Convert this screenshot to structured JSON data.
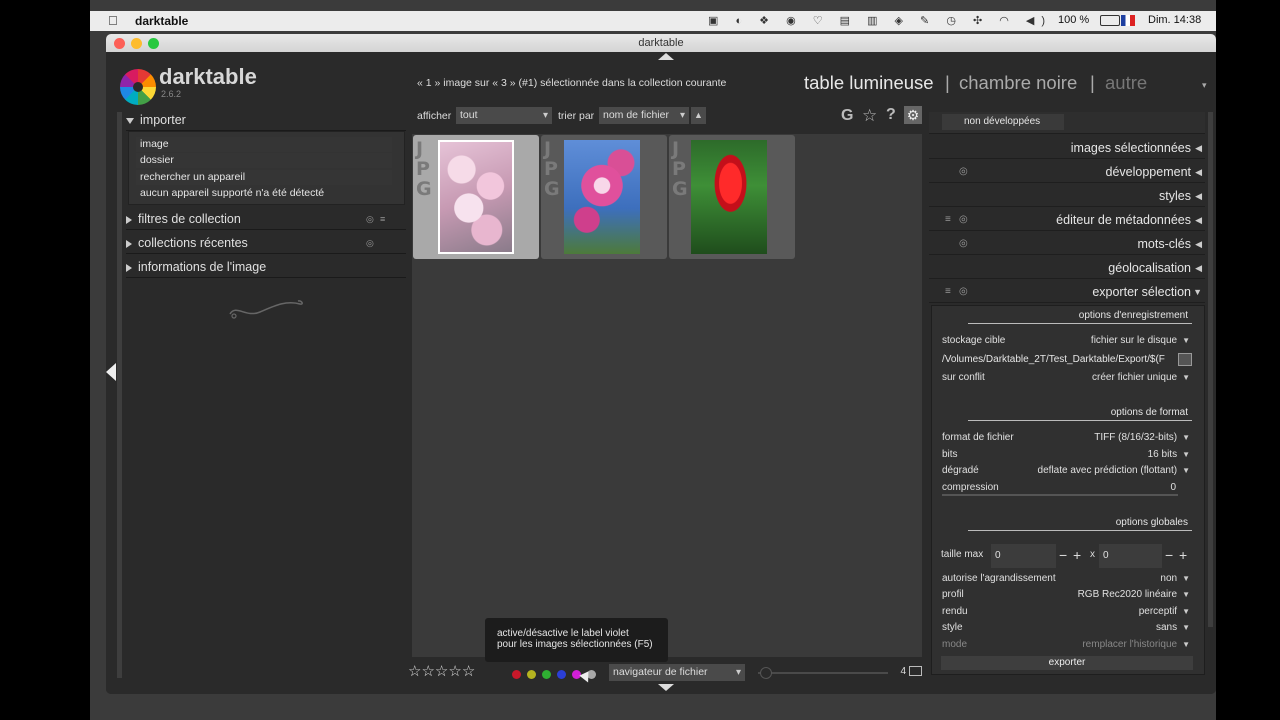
{
  "menubar": {
    "apple": "",
    "app_name": "darktable",
    "battery": "100 %",
    "datetime": "Dim. 14:38"
  },
  "window": {
    "title": "darktable"
  },
  "logo": {
    "name": "darktable",
    "version": "2.6.2"
  },
  "views": {
    "lighttable": "table lumineuse",
    "sep1": "|",
    "darkroom": "chambre noire",
    "sep2": "|",
    "other": "autre"
  },
  "status_text": "« 1 » image sur « 3 » (#1) sélectionnée dans la collection courante",
  "left": {
    "import": {
      "title": "importer",
      "items": [
        "image",
        "dossier",
        "rechercher un appareil",
        "aucun appareil supporté n'a été détecté"
      ]
    },
    "filters": "filtres de collection",
    "recent": "collections récentes",
    "info": "informations de l'image"
  },
  "toolbar": {
    "show_label": "afficher",
    "show_value": "tout",
    "sort_label": "trier par",
    "sort_value": "nom de fichier",
    "g": "G"
  },
  "thumbs": {
    "jpg": "JPG"
  },
  "right": {
    "top_value": "non développées",
    "sections": [
      "images sélectionnées",
      "développement",
      "styles",
      "éditeur de métadonnées",
      "mots-clés",
      "géolocalisation",
      "exporter sélection"
    ],
    "export": {
      "save_options": "options d'enregistrement",
      "storage_label": "stockage cible",
      "storage_value": "fichier sur le disque",
      "path": "/Volumes/Darktable_2T/Test_Darktable/Export/$(F",
      "conflict_label": "sur conflit",
      "conflict_value": "créer fichier unique",
      "format_options": "options de format",
      "file_format_label": "format de fichier",
      "file_format_value": "TIFF (8/16/32-bits)",
      "bits_label": "bits",
      "bits_value": "16 bits",
      "compress_label": "dégradé",
      "compress_value": "deflate avec prédiction (flottant)",
      "compression_label": "compression",
      "compression_value": "0",
      "global_options": "options globales",
      "maxsize_label": "taille max",
      "maxsize_w": "0",
      "maxsize_x": "x",
      "maxsize_h": "0",
      "upscale_label": "autorise l'agrandissement",
      "upscale_value": "non",
      "profile_label": "profil",
      "profile_value": "RGB Rec2020 linéaire",
      "intent_label": "rendu",
      "intent_value": "perceptif",
      "style_label": "style",
      "style_value": "sans",
      "mode_label": "mode",
      "mode_value": "remplacer l'historique",
      "export_button": "exporter"
    }
  },
  "tooltip": {
    "line1": "active/désactive le label violet",
    "line2": "pour les images sélectionnées (F5)"
  },
  "bottom": {
    "navigator": "navigateur de fichier",
    "zoom_count": "4"
  }
}
